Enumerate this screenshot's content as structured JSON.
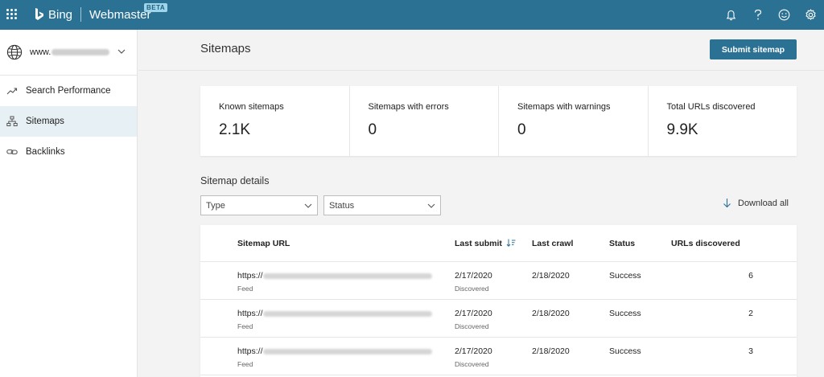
{
  "topbar": {
    "brand": "Bing",
    "product": "Webmaster",
    "badge": "BETA",
    "icons": [
      "apps-grid-icon",
      "bell-icon",
      "help-icon",
      "smiley-icon",
      "gear-icon"
    ]
  },
  "sidebar": {
    "site_prefix": "www.",
    "items": [
      {
        "label": "Search Performance",
        "icon": "trend-icon",
        "active": false
      },
      {
        "label": "Sitemaps",
        "icon": "sitemap-icon",
        "active": true
      },
      {
        "label": "Backlinks",
        "icon": "link-icon",
        "active": false
      }
    ]
  },
  "page": {
    "title": "Sitemaps",
    "submit_label": "Submit sitemap"
  },
  "stats": [
    {
      "label": "Known sitemaps",
      "value": "2.1K"
    },
    {
      "label": "Sitemaps with errors",
      "value": "0"
    },
    {
      "label": "Sitemaps with warnings",
      "value": "0"
    },
    {
      "label": "Total URLs discovered",
      "value": "9.9K"
    }
  ],
  "details": {
    "title": "Sitemap details",
    "filter_type": "Type",
    "filter_status": "Status",
    "download_label": "Download all"
  },
  "table": {
    "columns": [
      "Sitemap URL",
      "Last submit",
      "Last crawl",
      "Status",
      "URLs discovered"
    ],
    "rows": [
      {
        "url_prefix": "https://",
        "type": "Feed",
        "last_submit": "2/17/2020",
        "submit_note": "Discovered",
        "last_crawl": "2/18/2020",
        "status": "Success",
        "urls": "6"
      },
      {
        "url_prefix": "https://",
        "type": "Feed",
        "last_submit": "2/17/2020",
        "submit_note": "Discovered",
        "last_crawl": "2/18/2020",
        "status": "Success",
        "urls": "2"
      },
      {
        "url_prefix": "https://",
        "type": "Feed",
        "last_submit": "2/17/2020",
        "submit_note": "Discovered",
        "last_crawl": "2/18/2020",
        "status": "Success",
        "urls": "3"
      }
    ]
  },
  "colors": {
    "accent": "#2b7194",
    "active_nav": "#e7f0f4",
    "background": "#f3f3f3"
  }
}
